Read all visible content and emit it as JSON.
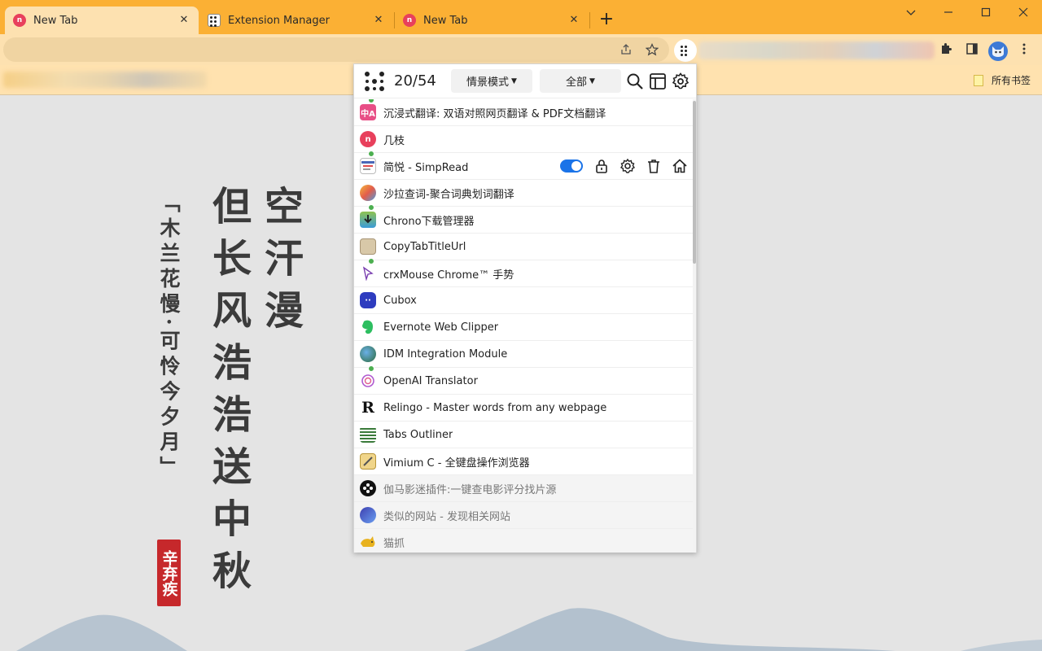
{
  "tabs": [
    {
      "title": "New Tab",
      "favicon": "nt-logo-icon",
      "active": true
    },
    {
      "title": "Extension Manager",
      "favicon": "extension-manager-icon",
      "active": false
    },
    {
      "title": "New Tab",
      "favicon": "nt-logo-icon",
      "active": false
    }
  ],
  "tab_close_glyph": "✕",
  "new_tab_glyph": "+",
  "window_controls": {
    "minimize": "minimize",
    "maximize": "maximize",
    "close": "close"
  },
  "colors": {
    "tabstrip": "#fbb034",
    "toolbar": "#fde1b0",
    "toggle_on": "#1a73e8",
    "seal": "#c6282b"
  },
  "bookmarks": {
    "all_bookmarks_label": "所有书签"
  },
  "page": {
    "poem_col1": "空汗漫",
    "poem_col2": "但长风浩浩送中秋",
    "poem_title": "「木兰花慢·可怜今夕月」",
    "poet_seal": "辛弃疾"
  },
  "popup": {
    "count": "20/54",
    "mode_select": "情景模式",
    "filter_select": "全部",
    "extensions": [
      {
        "name": "沉浸式翻译: 双语对照网页翻译 & PDF文档翻译",
        "icon": "immersive-translate-icon",
        "badge": true,
        "enabled": true
      },
      {
        "name": "几枝",
        "icon": "jizhi-icon",
        "badge": false,
        "enabled": true
      },
      {
        "name": "简悦 - SimpRead",
        "icon": "simpread-icon",
        "badge": true,
        "enabled": true,
        "hovered": true
      },
      {
        "name": "沙拉查词-聚合词典划词翻译",
        "icon": "saladict-icon",
        "badge": false,
        "enabled": true
      },
      {
        "name": "Chrono下载管理器",
        "icon": "chrono-download-icon",
        "badge": true,
        "enabled": true
      },
      {
        "name": "CopyTabTitleUrl",
        "icon": "clipboard-icon",
        "badge": false,
        "enabled": true
      },
      {
        "name": "crxMouse Chrome™ 手势",
        "icon": "mouse-gesture-icon",
        "badge": true,
        "enabled": true
      },
      {
        "name": "Cubox",
        "icon": "cubox-icon",
        "badge": false,
        "enabled": true
      },
      {
        "name": "Evernote Web Clipper",
        "icon": "evernote-icon",
        "badge": false,
        "enabled": true
      },
      {
        "name": "IDM Integration Module",
        "icon": "idm-icon",
        "badge": false,
        "enabled": true
      },
      {
        "name": "OpenAI Translator",
        "icon": "openai-icon",
        "badge": true,
        "enabled": true
      },
      {
        "name": "Relingo - Master words from any webpage",
        "icon": "relingo-icon",
        "badge": false,
        "enabled": true
      },
      {
        "name": "Tabs Outliner",
        "icon": "tabs-outliner-icon",
        "badge": false,
        "enabled": true
      },
      {
        "name": "Vimium C - 全键盘操作浏览器",
        "icon": "vimium-icon",
        "badge": false,
        "enabled": true
      },
      {
        "name": "伽马影迷插件:一键查电影评分找片源",
        "icon": "film-reel-icon",
        "badge": false,
        "enabled": false
      },
      {
        "name": "类似的网站 - 发现相关网站",
        "icon": "similar-sites-icon",
        "badge": false,
        "enabled": false
      },
      {
        "name": "猫抓",
        "icon": "cat-catch-icon",
        "badge": false,
        "enabled": false
      }
    ]
  }
}
